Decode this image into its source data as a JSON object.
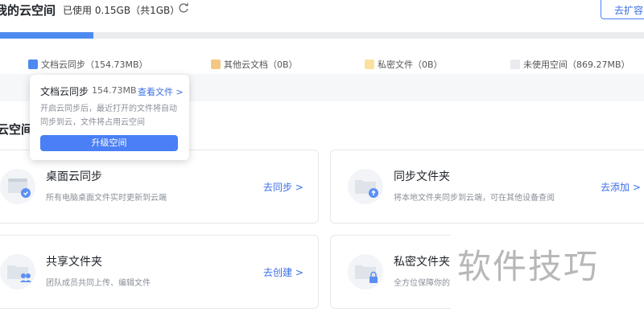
{
  "header": {
    "title": "我的云空间",
    "usage": "已使用 0.15GB（共1GB）",
    "expand_button": "去扩容"
  },
  "storage": {
    "used_fraction": 0.15,
    "bar_color": "#4d8af0"
  },
  "legend": [
    {
      "label": "文档云同步（154.73MB）",
      "color": "#4d8af0"
    },
    {
      "label": "其他云文档（0B）",
      "color": "#f5c784"
    },
    {
      "label": "私密文件（0B）",
      "color": "#fbe0a0"
    },
    {
      "label": "未使用空间（869.27MB）",
      "color": "#e9ebef"
    }
  ],
  "popup": {
    "title": "文档云同步",
    "size": "154.73MB",
    "link": "查看文件 >",
    "description": "开启云同步后，最近打开的文件将自动同步到云，文件将占用云空间",
    "upgrade_button": "升级空间"
  },
  "section_title": "云空间",
  "cards": [
    {
      "title": "桌面云同步",
      "desc": "所有电脑桌面文件实时更新到云端",
      "action": "去同步 >",
      "icon": "desktop-sync-icon"
    },
    {
      "title": "同步文件夹",
      "desc": "将本地文件夹同步到云端，可在其他设备查阅",
      "action": "去添加 >",
      "icon": "sync-folder-icon"
    },
    {
      "title": "共享文件夹",
      "desc": "团队成员共同上传、编辑文件",
      "action": "去创建 >",
      "icon": "shared-folder-icon"
    },
    {
      "title": "私密文件夹",
      "desc": "全方位保障你的",
      "action": "",
      "icon": "private-folder-icon"
    }
  ],
  "watermark": "软件技巧"
}
